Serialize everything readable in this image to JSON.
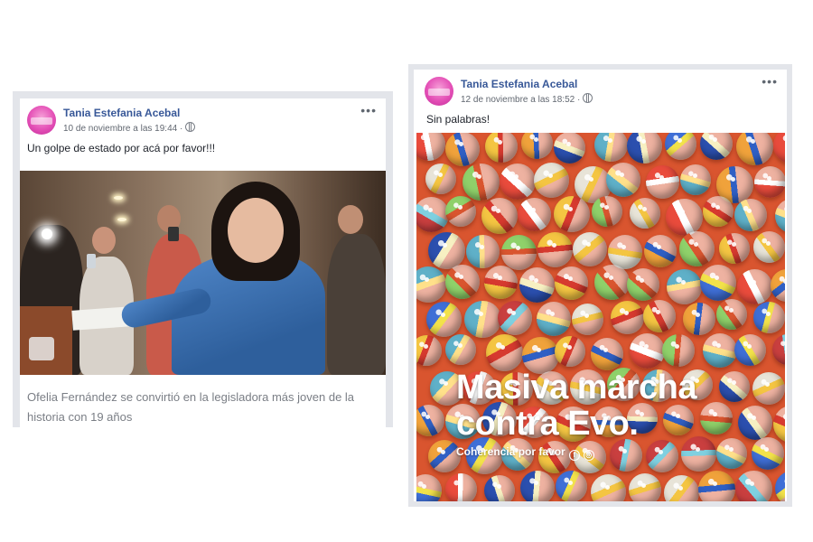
{
  "posts": [
    {
      "author": "Tania Estefania Acebal",
      "timestamp": "10 de noviembre a las 19:44 ·",
      "text": "Un golpe de estado por acá por favor!!!",
      "link_caption": "Ofelia Fernández se convirtió en la legisladora más joven de la historia con 19 años",
      "more_icon": "more-options-icon",
      "privacy_icon": "globe-icon"
    },
    {
      "author": "Tania Estefania Acebal",
      "timestamp": "12 de noviembre a las 18:52 ·",
      "text": "Sin palabras!",
      "image_title": "Masiva marcha contra Evo.",
      "image_subtitle": "Coherencia por favor",
      "more_icon": "more-options-icon",
      "privacy_icon": "globe-icon"
    }
  ],
  "colors": {
    "author_link": "#385898",
    "meta_text": "#616770",
    "caption_text": "#7a7e85",
    "marble_background": "#d9552f"
  }
}
